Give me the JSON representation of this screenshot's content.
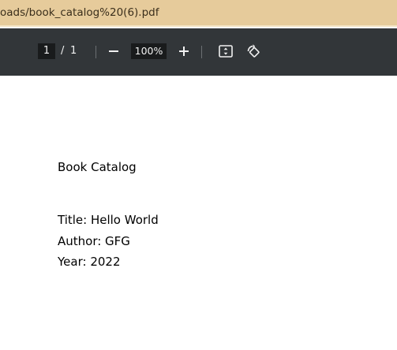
{
  "address_bar": {
    "url_text": "oads/book_catalog%20(6).pdf"
  },
  "pdf_toolbar": {
    "current_page": "1",
    "page_separator": "/",
    "total_pages": "1",
    "zoom_level": "100%",
    "icons": [
      "minus-icon",
      "plus-icon",
      "fit-to-page-icon",
      "rotate-icon"
    ]
  },
  "document": {
    "heading": "Book Catalog",
    "title_line": "Title: Hello World",
    "author_line": "Author: GFG",
    "year_line": "Year: 2022"
  }
}
